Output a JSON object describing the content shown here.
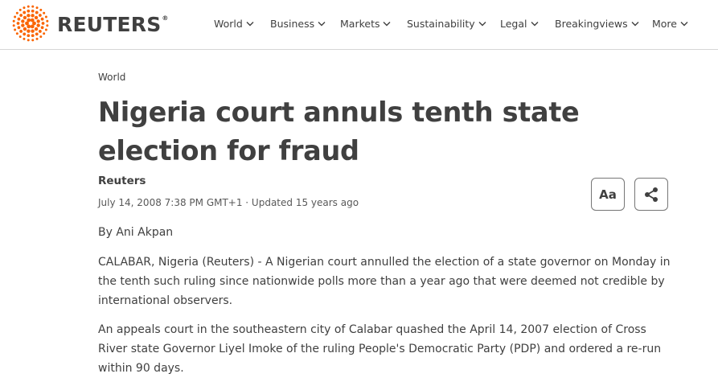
{
  "brand": {
    "name": "REUTERS",
    "registered": "®",
    "accent_color": "#fa6400"
  },
  "nav": {
    "items": [
      {
        "label": "World",
        "icon": "chevron-down-icon"
      },
      {
        "label": "Business",
        "icon": "chevron-down-icon"
      },
      {
        "label": "Markets",
        "icon": "chevron-down-icon"
      },
      {
        "label": "Sustainability",
        "icon": "chevron-down-icon"
      },
      {
        "label": "Legal",
        "icon": "chevron-down-icon"
      },
      {
        "label": "Breakingviews",
        "icon": "chevron-down-icon"
      },
      {
        "label": "More",
        "icon": "chevron-down-icon"
      }
    ]
  },
  "article": {
    "section": "World",
    "headline": "Nigeria court annuls tenth state election for fraud",
    "author": "Reuters",
    "dateline": "July 14, 2008 7:38 PM GMT+1 · Updated 15 years ago",
    "text_size_button": "Aa",
    "share_icon": "share-icon",
    "byline": "By Ani Akpan",
    "paragraphs": [
      "CALABAR, Nigeria (Reuters) - A Nigerian court annulled the election of a state governor on Monday in the tenth such ruling since nationwide polls more than a year ago that were deemed not credible by international observers.",
      "An appeals court in the southeastern city of Calabar quashed the April 14, 2007 election of Cross River state Governor Liyel Imoke of the ruling People's Democratic Party (PDP) and ordered a re-run within 90 days."
    ]
  }
}
